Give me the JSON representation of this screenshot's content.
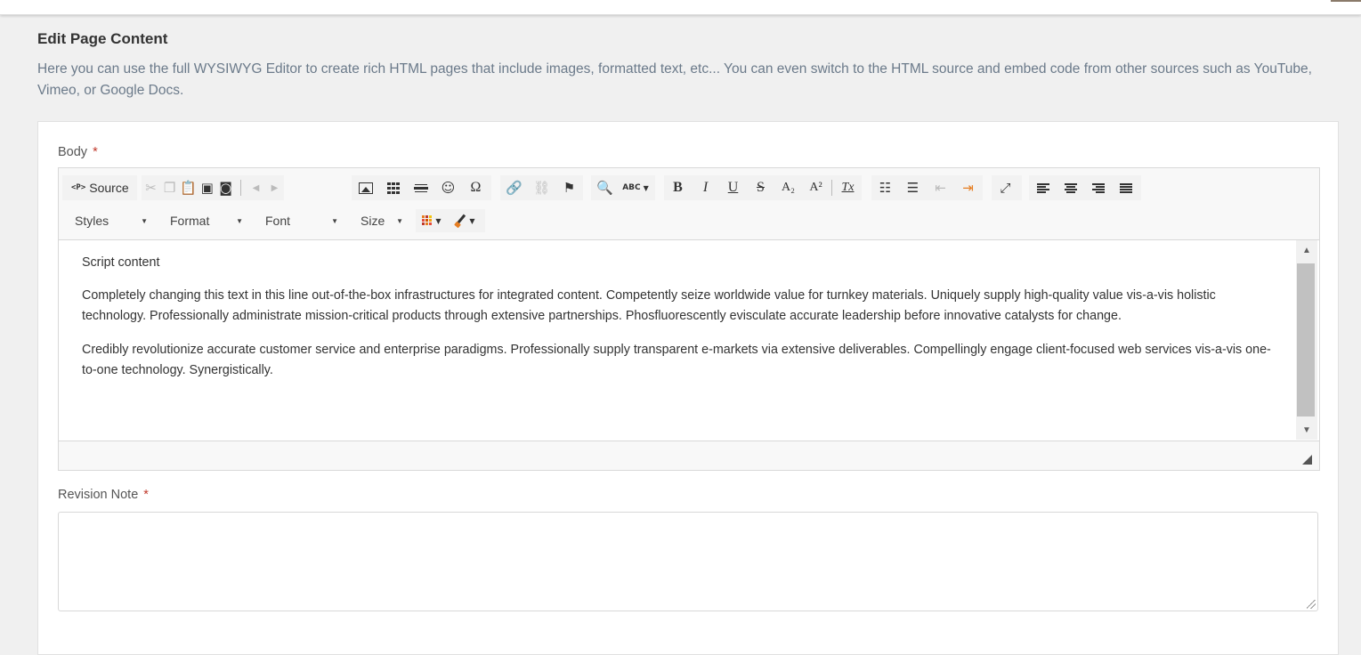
{
  "header": {
    "title": "Edit Page Content",
    "description": "Here you can use the full WYSIWYG Editor to create rich HTML pages that include images, formatted text, etc... You can even switch to the HTML source and embed code from other sources such as YouTube, Vimeo, or Google Docs."
  },
  "body_field": {
    "label": "Body",
    "required_mark": "*"
  },
  "toolbar": {
    "source_tag": "<P>",
    "source_label": "Source",
    "styles_label": "Styles",
    "format_label": "Format",
    "font_label": "Font",
    "size_label": "Size",
    "buttons": {
      "bold": "B",
      "italic": "I",
      "underline": "U",
      "strike": "S",
      "subscript": "A₂",
      "superscript": "A²",
      "remove_format": "Tx",
      "special_char": "Ω",
      "spellcheck": "ABC"
    }
  },
  "content": {
    "paragraphs": [
      "Script content",
      "Completely changing this text in this line out-of-the-box infrastructures for integrated content. Competently seize worldwide value for turnkey materials. Uniquely supply high-quality value vis-a-vis holistic technology. Professionally administrate mission-critical products through extensive partnerships. Phosfluorescently evisculate accurate leadership before innovative catalysts for change.",
      "Credibly revolutionize accurate customer service and enterprise paradigms. Professionally supply transparent e-markets via extensive deliverables. Compellingly engage client-focused web services vis-a-vis one-to-one technology. Synergistically."
    ]
  },
  "revision_field": {
    "label": "Revision Note",
    "required_mark": "*",
    "value": ""
  },
  "colors": {
    "page_bg": "#f0f0f0",
    "description_text": "#6b7a8a",
    "required": "#c0392b",
    "toolbar_bg": "#f8f8f8"
  }
}
